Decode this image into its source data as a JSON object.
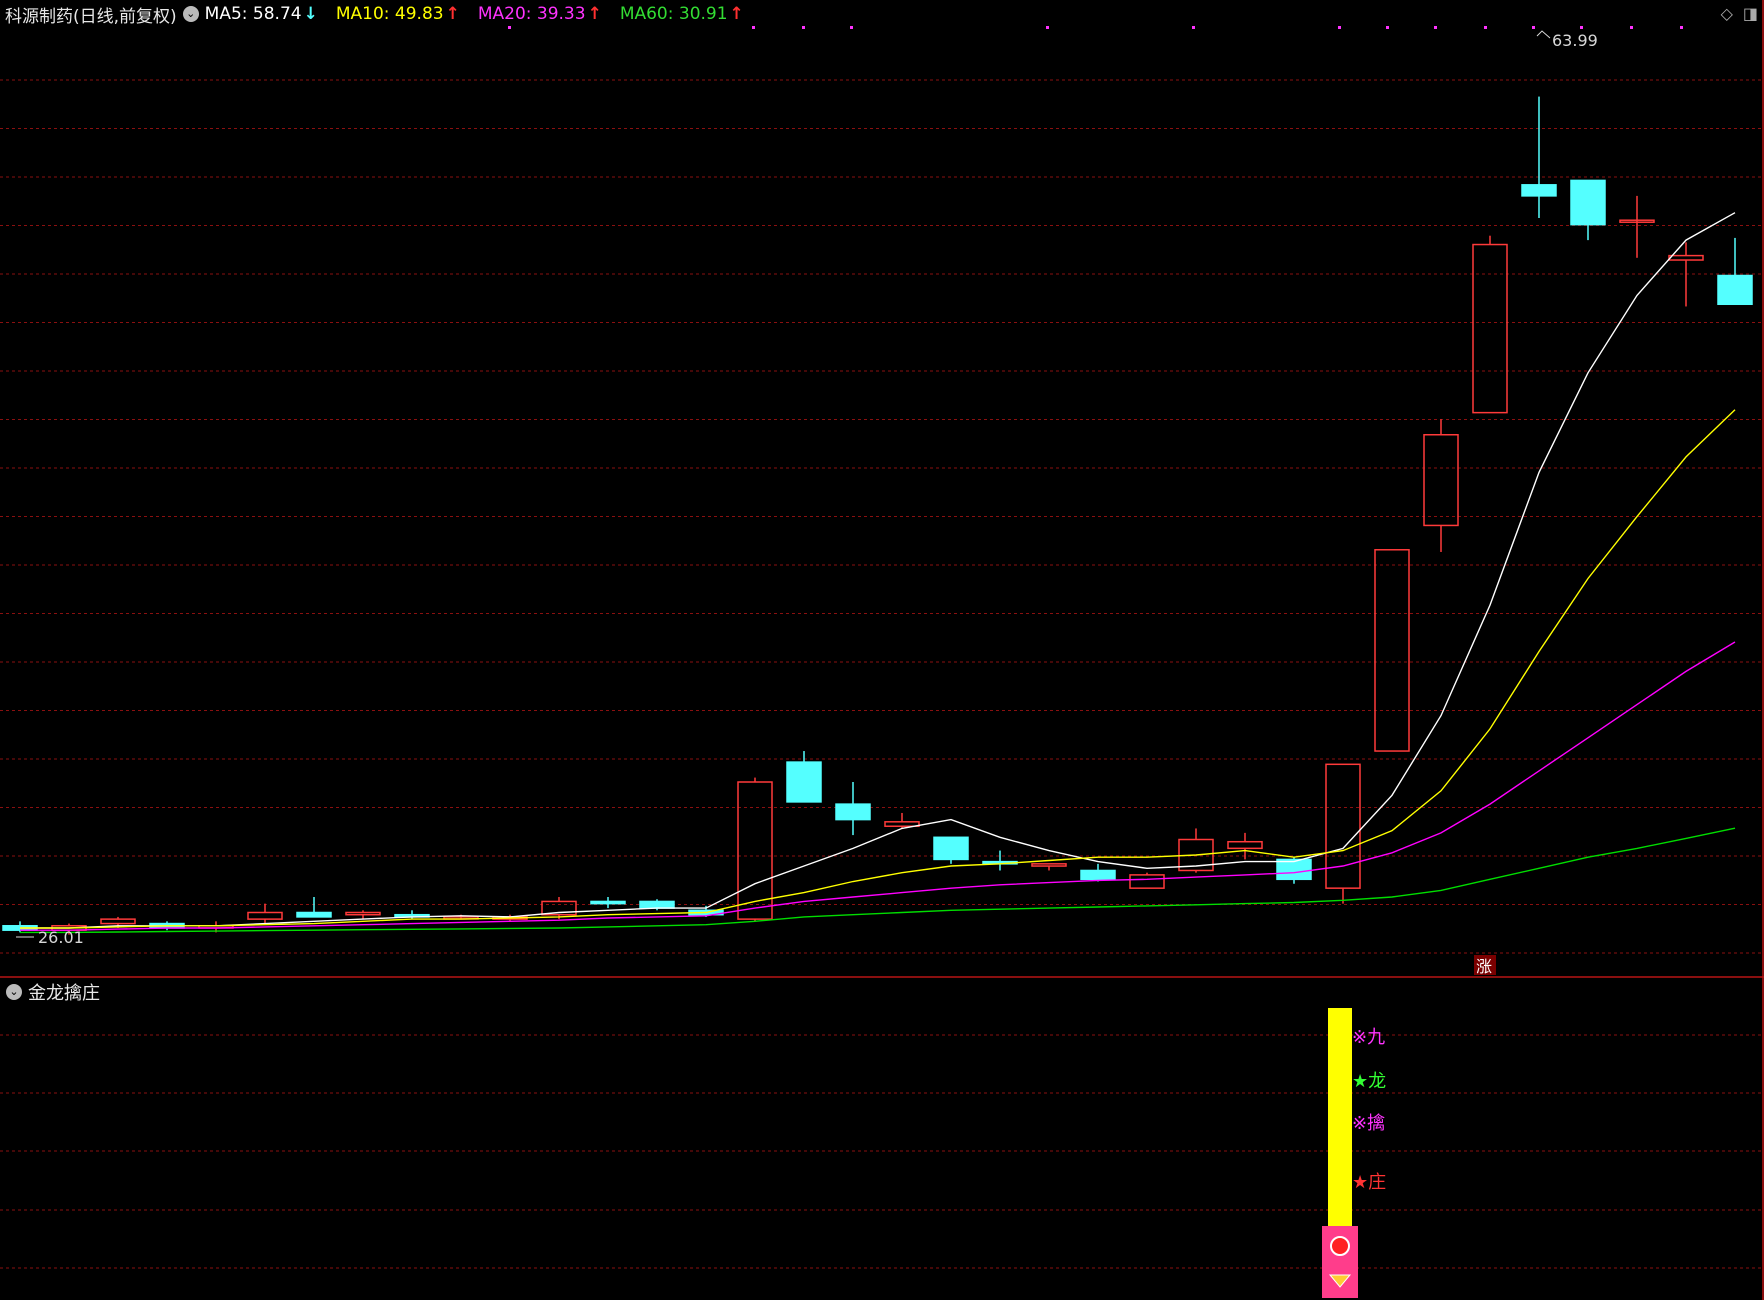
{
  "header": {
    "stock_title": "科源制药(日线,前复权)",
    "ma5_label": "MA5: 58.74",
    "ma5_arrow": "↓",
    "ma10_label": "MA10: 49.83",
    "ma10_arrow": "↑",
    "ma20_label": "MA20: 39.33",
    "ma20_arrow": "↑",
    "ma60_label": "MA60: 30.91",
    "ma60_arrow": "↑"
  },
  "colors": {
    "background": "#000000",
    "grid": "#8a1010",
    "up_candle": "#ff3a3a",
    "down_candle": "#54ffff",
    "ma5": "#ffffff",
    "ma10": "#ffff00",
    "ma20": "#ff00ff",
    "ma60": "#00dd00"
  },
  "icons": [
    "settings-circle-icon",
    "diamond-icon",
    "window-toggle-icon"
  ],
  "annotations": {
    "high_label": "63.99",
    "low_label": "26.01",
    "zhang_label": "涨"
  },
  "indicator": {
    "title": "金龙擒庄",
    "labels": [
      {
        "symbol": "※",
        "text": "九",
        "color": "#ff33ff"
      },
      {
        "symbol": "★",
        "text": "龙",
        "color": "#33ff33"
      },
      {
        "symbol": "※",
        "text": "擒",
        "color": "#ff33ff"
      },
      {
        "symbol": "★",
        "text": "庄",
        "color": "#ff3333"
      }
    ],
    "bar_color": "#ffff00",
    "box_color": "#ff3d8b"
  },
  "chart_data": {
    "type": "candlestick",
    "ylim": [
      24.5,
      67
    ],
    "candles": [
      {
        "o": 26.5,
        "h": 26.7,
        "l": 26.2,
        "c": 26.3
      },
      {
        "o": 26.3,
        "h": 26.6,
        "l": 26.1,
        "c": 26.5
      },
      {
        "o": 26.6,
        "h": 26.9,
        "l": 26.4,
        "c": 26.8
      },
      {
        "o": 26.6,
        "h": 26.7,
        "l": 26.3,
        "c": 26.4
      },
      {
        "o": 26.4,
        "h": 26.7,
        "l": 26.2,
        "c": 26.5
      },
      {
        "o": 26.8,
        "h": 27.5,
        "l": 26.6,
        "c": 27.1
      },
      {
        "o": 27.1,
        "h": 27.8,
        "l": 26.9,
        "c": 26.9
      },
      {
        "o": 27.0,
        "h": 27.2,
        "l": 26.8,
        "c": 27.1
      },
      {
        "o": 27.0,
        "h": 27.2,
        "l": 26.8,
        "c": 26.9
      },
      {
        "o": 26.9,
        "h": 27.0,
        "l": 26.8,
        "c": 26.9
      },
      {
        "o": 26.8,
        "h": 27.0,
        "l": 26.7,
        "c": 26.9
      },
      {
        "o": 27.0,
        "h": 27.8,
        "l": 26.8,
        "c": 27.6
      },
      {
        "o": 27.6,
        "h": 27.8,
        "l": 27.3,
        "c": 27.5
      },
      {
        "o": 27.6,
        "h": 27.7,
        "l": 27.2,
        "c": 27.3
      },
      {
        "o": 27.2,
        "h": 27.4,
        "l": 26.9,
        "c": 27.0
      },
      {
        "o": 26.8,
        "h": 33.2,
        "l": 26.7,
        "c": 33.0
      },
      {
        "o": 33.9,
        "h": 34.4,
        "l": 32.3,
        "c": 32.1
      },
      {
        "o": 32.0,
        "h": 33.0,
        "l": 30.6,
        "c": 31.3
      },
      {
        "o": 31.0,
        "h": 31.6,
        "l": 30.9,
        "c": 31.2
      },
      {
        "o": 30.5,
        "h": 30.5,
        "l": 29.3,
        "c": 29.5
      },
      {
        "o": 29.4,
        "h": 29.9,
        "l": 29.0,
        "c": 29.3
      },
      {
        "o": 29.2,
        "h": 29.3,
        "l": 29.0,
        "c": 29.3
      },
      {
        "o": 29.0,
        "h": 29.3,
        "l": 28.5,
        "c": 28.6
      },
      {
        "o": 28.2,
        "h": 28.9,
        "l": 28.2,
        "c": 28.8
      },
      {
        "o": 29.0,
        "h": 30.9,
        "l": 28.9,
        "c": 30.4
      },
      {
        "o": 30.0,
        "h": 30.7,
        "l": 29.5,
        "c": 30.3
      },
      {
        "o": 29.5,
        "h": 29.6,
        "l": 28.4,
        "c": 28.6
      },
      {
        "o": 28.2,
        "h": 33.8,
        "l": 27.5,
        "c": 33.8
      },
      {
        "o": 34.4,
        "h": 43.5,
        "l": 34.4,
        "c": 43.5
      },
      {
        "o": 44.6,
        "h": 49.4,
        "l": 43.4,
        "c": 48.7
      },
      {
        "o": 49.7,
        "h": 57.7,
        "l": 49.7,
        "c": 57.3
      },
      {
        "o": 60.0,
        "h": 63.99,
        "l": 58.5,
        "c": 59.5
      },
      {
        "o": 60.2,
        "h": 60.2,
        "l": 57.5,
        "c": 58.2
      },
      {
        "o": 58.4,
        "h": 59.5,
        "l": 56.7,
        "c": 58.4
      },
      {
        "o": 56.6,
        "h": 57.4,
        "l": 54.5,
        "c": 56.8
      },
      {
        "o": 55.9,
        "h": 57.6,
        "l": 54.7,
        "c": 54.6
      }
    ],
    "ma5": [
      26.4,
      26.4,
      26.5,
      26.5,
      26.5,
      26.6,
      26.7,
      26.8,
      26.9,
      26.95,
      26.9,
      27.1,
      27.2,
      27.3,
      27.3,
      28.4,
      29.2,
      30.0,
      30.9,
      31.3,
      30.5,
      29.9,
      29.4,
      29.1,
      29.2,
      29.4,
      29.4,
      30.0,
      32.4,
      36.0,
      41.0,
      47.0,
      51.5,
      55.0,
      57.5,
      58.74
    ],
    "ma10": [
      26.4,
      26.4,
      26.45,
      26.5,
      26.5,
      26.55,
      26.6,
      26.7,
      26.8,
      26.8,
      26.85,
      26.9,
      27.0,
      27.05,
      27.1,
      27.6,
      28.0,
      28.5,
      28.9,
      29.2,
      29.3,
      29.45,
      29.6,
      29.6,
      29.7,
      29.9,
      29.6,
      29.9,
      30.8,
      32.6,
      35.4,
      38.9,
      42.2,
      45.0,
      47.7,
      49.83
    ],
    "ma20": [
      26.3,
      26.3,
      26.35,
      26.4,
      26.4,
      26.45,
      26.5,
      26.55,
      26.6,
      26.65,
      26.7,
      26.75,
      26.85,
      26.9,
      26.95,
      27.3,
      27.6,
      27.8,
      28.0,
      28.2,
      28.35,
      28.45,
      28.55,
      28.6,
      28.7,
      28.8,
      28.9,
      29.2,
      29.8,
      30.7,
      32.0,
      33.5,
      35.0,
      36.5,
      38.0,
      39.33
    ],
    "ma60": [
      26.2,
      26.2,
      26.22,
      26.24,
      26.26,
      26.28,
      26.3,
      26.32,
      26.34,
      26.36,
      26.38,
      26.4,
      26.45,
      26.5,
      26.55,
      26.7,
      26.9,
      27.0,
      27.1,
      27.2,
      27.25,
      27.3,
      27.35,
      27.4,
      27.45,
      27.5,
      27.55,
      27.65,
      27.8,
      28.1,
      28.6,
      29.1,
      29.6,
      30.0,
      30.45,
      30.91
    ]
  }
}
